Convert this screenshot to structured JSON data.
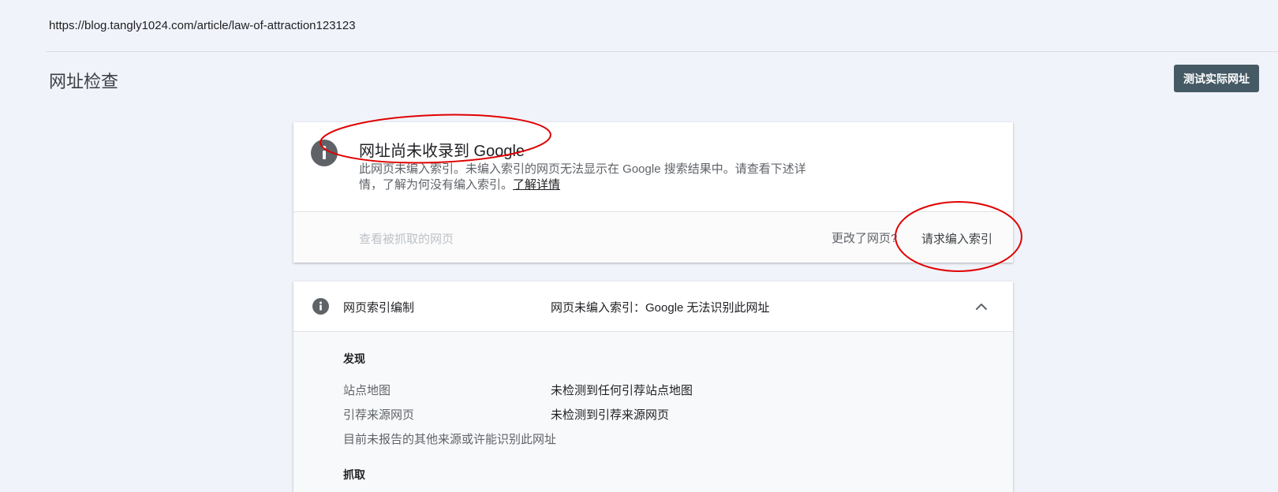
{
  "url_bar": {
    "url": "https://blog.tangly1024.com/article/law-of-attraction123123"
  },
  "header": {
    "title": "网址检查",
    "test_live_label": "测试实际网址"
  },
  "status_card": {
    "icon": "info-icon",
    "heading": "网址尚未收录到 Google",
    "description": "此网页未编入索引。未编入索引的网页无法显示在 Google 搜索结果中。请查看下述详情，了解为何没有编入索引。",
    "learn_more": "了解详情",
    "view_crawled_label": "查看被抓取的网页",
    "page_changed_label": "更改了网页?",
    "request_index_label": "请求编入索引"
  },
  "index_card": {
    "icon": "info-icon",
    "label": "网页索引编制",
    "status": "网页未编入索引：Google 无法识别此网址",
    "expand_icon": "chevron-up-icon",
    "discovery": {
      "title": "发现",
      "rows": [
        {
          "label": "站点地图",
          "value": "未检测到任何引荐站点地图"
        },
        {
          "label": "引荐来源网页",
          "value": "未检测到引荐来源网页"
        }
      ],
      "note": "目前未报告的其他来源或许能识别此网址"
    },
    "crawl": {
      "title": "抓取"
    }
  },
  "colors": {
    "page_bg": "#f1f3fa",
    "button_bg": "#455a64",
    "annotation_red": "#e00000",
    "icon_grey": "#5f6368"
  }
}
